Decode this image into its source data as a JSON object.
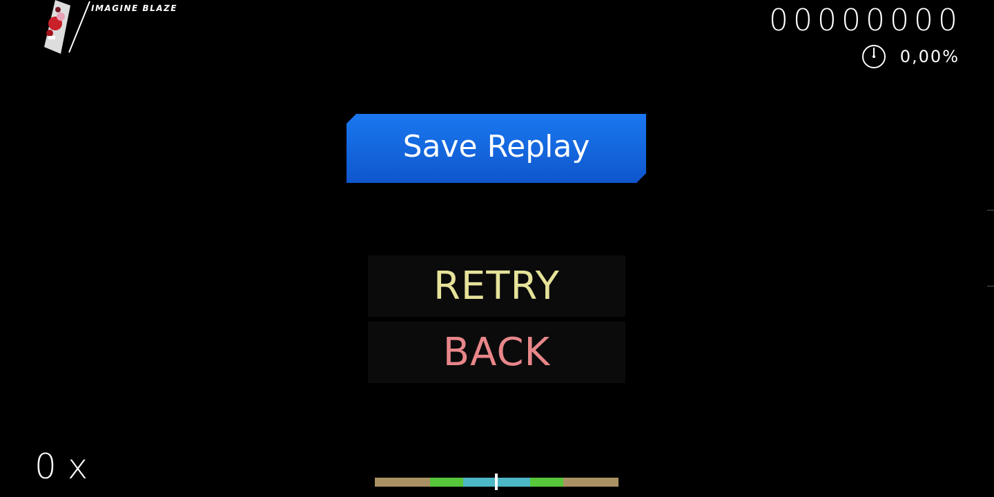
{
  "skin": {
    "name": "IMAGINE BLAZE"
  },
  "hud": {
    "score": "00000000",
    "accuracy": "0,00%",
    "accuracy_icon": "clock-icon",
    "combo": "0 x"
  },
  "pause_menu": {
    "save_replay_label": "Save Replay",
    "retry_label": "RETRY",
    "back_label": "BACK"
  },
  "colors": {
    "background": "#000000",
    "save_button": "#1565e0",
    "retry_text": "#e6e29a",
    "back_text": "#e8868a",
    "hit_50": "#a99163",
    "hit_100": "#57c63a",
    "hit_300": "#4cb7c5"
  }
}
